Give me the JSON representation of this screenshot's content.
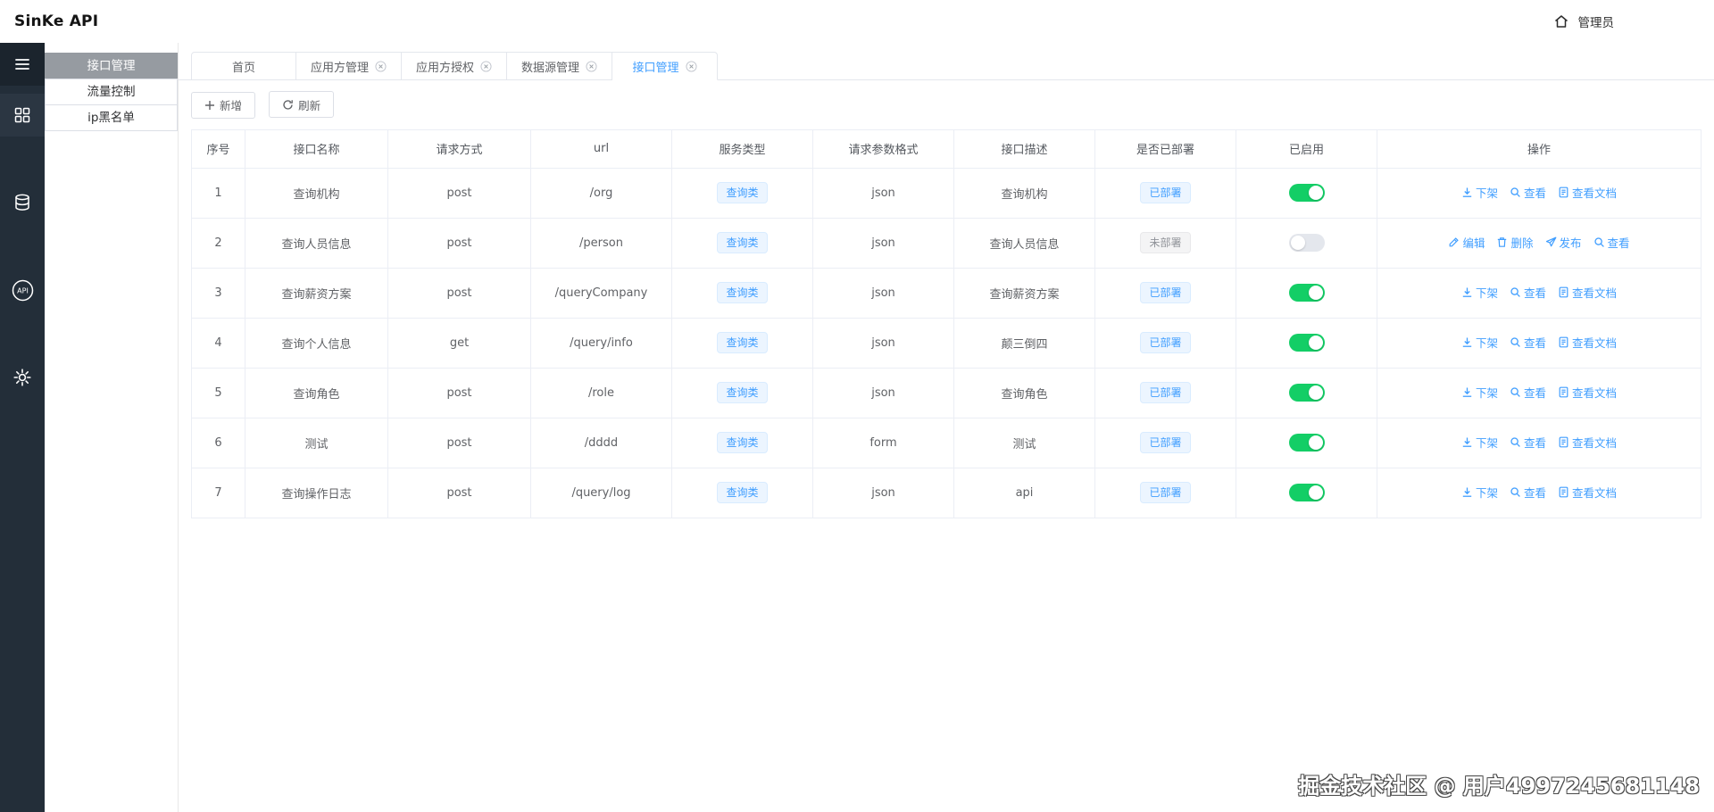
{
  "topbar": {
    "logo": "SinKe API",
    "user": "管理员"
  },
  "left_rail": {
    "items": [
      {
        "icon": "menu-icon"
      },
      {
        "icon": "grid-icon"
      },
      {
        "icon": "database-icon"
      },
      {
        "icon": "api-icon"
      },
      {
        "icon": "gear-icon"
      }
    ]
  },
  "sidebar": {
    "items": [
      {
        "label": "接口管理",
        "active": true
      },
      {
        "label": "流量控制",
        "active": false
      },
      {
        "label": "ip黑名单",
        "active": false
      }
    ]
  },
  "tabs": [
    {
      "label": "首页",
      "closable": false,
      "active": false
    },
    {
      "label": "应用方管理",
      "closable": true,
      "active": false
    },
    {
      "label": "应用方授权",
      "closable": true,
      "active": false
    },
    {
      "label": "数据源管理",
      "closable": true,
      "active": false
    },
    {
      "label": "接口管理",
      "closable": true,
      "active": true
    }
  ],
  "toolbar": {
    "add_label": "新增",
    "refresh_label": "刷新"
  },
  "table": {
    "columns": [
      "序号",
      "接口名称",
      "请求方式",
      "url",
      "服务类型",
      "请求参数格式",
      "接口描述",
      "是否已部署",
      "已启用",
      "操作"
    ],
    "rows": [
      {
        "index": 1,
        "name": "查询机构",
        "method": "post",
        "url": "/org",
        "service_type": "查询类",
        "param_format": "json",
        "description": "查询机构",
        "deploy_status": "已部署",
        "deployed": true,
        "enabled": true,
        "actions": [
          {
            "icon": "download-icon",
            "label": "下架"
          },
          {
            "icon": "search-icon",
            "label": "查看"
          },
          {
            "icon": "document-icon",
            "label": "查看文档"
          }
        ]
      },
      {
        "index": 2,
        "name": "查询人员信息",
        "method": "post",
        "url": "/person",
        "service_type": "查询类",
        "param_format": "json",
        "description": "查询人员信息",
        "deploy_status": "未部署",
        "deployed": false,
        "enabled": false,
        "actions": [
          {
            "icon": "edit-icon",
            "label": "编辑"
          },
          {
            "icon": "delete-icon",
            "label": "删除"
          },
          {
            "icon": "send-icon",
            "label": "发布"
          },
          {
            "icon": "search-icon",
            "label": "查看"
          }
        ]
      },
      {
        "index": 3,
        "name": "查询薪资方案",
        "method": "post",
        "url": "/queryCompany",
        "service_type": "查询类",
        "param_format": "json",
        "description": "查询薪资方案",
        "deploy_status": "已部署",
        "deployed": true,
        "enabled": true,
        "actions": [
          {
            "icon": "download-icon",
            "label": "下架"
          },
          {
            "icon": "search-icon",
            "label": "查看"
          },
          {
            "icon": "document-icon",
            "label": "查看文档"
          }
        ]
      },
      {
        "index": 4,
        "name": "查询个人信息",
        "method": "get",
        "url": "/query/info",
        "service_type": "查询类",
        "param_format": "json",
        "description": "颠三倒四",
        "deploy_status": "已部署",
        "deployed": true,
        "enabled": true,
        "actions": [
          {
            "icon": "download-icon",
            "label": "下架"
          },
          {
            "icon": "search-icon",
            "label": "查看"
          },
          {
            "icon": "document-icon",
            "label": "查看文档"
          }
        ]
      },
      {
        "index": 5,
        "name": "查询角色",
        "method": "post",
        "url": "/role",
        "service_type": "查询类",
        "param_format": "json",
        "description": "查询角色",
        "deploy_status": "已部署",
        "deployed": true,
        "enabled": true,
        "actions": [
          {
            "icon": "download-icon",
            "label": "下架"
          },
          {
            "icon": "search-icon",
            "label": "查看"
          },
          {
            "icon": "document-icon",
            "label": "查看文档"
          }
        ]
      },
      {
        "index": 6,
        "name": "测试",
        "method": "post",
        "url": "/dddd",
        "service_type": "查询类",
        "param_format": "form",
        "description": "测试",
        "deploy_status": "已部署",
        "deployed": true,
        "enabled": true,
        "actions": [
          {
            "icon": "download-icon",
            "label": "下架"
          },
          {
            "icon": "search-icon",
            "label": "查看"
          },
          {
            "icon": "document-icon",
            "label": "查看文档"
          }
        ]
      },
      {
        "index": 7,
        "name": "查询操作日志",
        "method": "post",
        "url": "/query/log",
        "service_type": "查询类",
        "param_format": "json",
        "description": "api",
        "deploy_status": "已部署",
        "deployed": true,
        "enabled": true,
        "actions": [
          {
            "icon": "download-icon",
            "label": "下架"
          },
          {
            "icon": "search-icon",
            "label": "查看"
          },
          {
            "icon": "document-icon",
            "label": "查看文档"
          }
        ]
      }
    ]
  },
  "watermark": "掘金技术社区 @ 用户4997245681148",
  "colors": {
    "primary": "#409eff",
    "toggle_on": "#13ce66",
    "rail_bg": "#232e39",
    "tag_blue_bg": "#ecf5ff"
  }
}
